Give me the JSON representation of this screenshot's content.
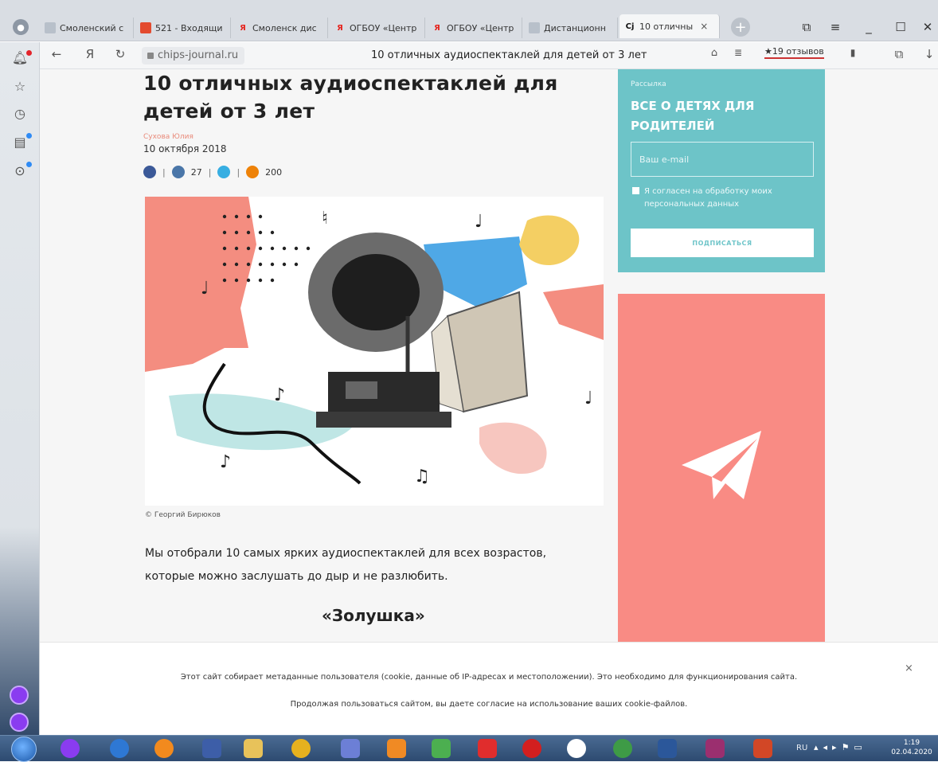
{
  "browser": {
    "tabs": [
      {
        "label": "Смоленский с",
        "icon": "page-icon"
      },
      {
        "label": "521 - Входящи",
        "icon": "mail-icon",
        "color": "#e34b2f"
      },
      {
        "label": "Смоленск дис",
        "icon": "yandex-icon",
        "color": "#e52620"
      },
      {
        "label": "ОГБОУ «Центр",
        "icon": "yandex-icon",
        "color": "#e52620"
      },
      {
        "label": "ОГБОУ «Центр",
        "icon": "yandex-icon",
        "color": "#e52620"
      },
      {
        "label": "Дистанционн",
        "icon": "page-icon"
      },
      {
        "label": "10 отличны",
        "icon": "chips-icon",
        "active": true
      }
    ],
    "close_tab": "×",
    "new_tab": "+",
    "address": {
      "domain": "chips-journal.ru",
      "page_title": "10 отличных аудиоспектаклей для детей от 3 лет",
      "reviews": "★19 отзывов"
    }
  },
  "article": {
    "title": "10 отличных аудиоспектаклей для детей от 3 лет",
    "author": "Сухова Юлия",
    "date": "10 октября 2018",
    "shares": {
      "vk": "27",
      "ok": "200"
    },
    "image_credit": "© Георгий Бирюков",
    "lead": "Мы отобрали 10 самых ярких аудиоспектаклей для всех возрастов, которые можно заслушать до дыр и не разлюбить.",
    "subheading": "«Золушка»"
  },
  "newsletter": {
    "kicker": "Рассылка",
    "title": "ВСЕ О ДЕТЯХ ДЛЯ РОДИТЕЛЕЙ",
    "email_placeholder": "Ваш e-mail",
    "consent": "Я согласен на обработку моих персональных данных",
    "button": "ПОДПИСАТЬСЯ"
  },
  "cookie": {
    "line1": "Этот сайт собирает метаданные пользователя (cookie, данные об IP-адресах и местоположении). Это необходимо для функционирования сайта.",
    "line2": "Продолжая пользоваться сайтом, вы даете согласие на использование ваших cookie-файлов.",
    "close": "×"
  },
  "taskbar": {
    "lang": "RU",
    "time": "1:19",
    "date": "02.04.2020"
  },
  "colors": {
    "accent_teal": "#6dc4c8",
    "accent_coral": "#f98b84"
  }
}
